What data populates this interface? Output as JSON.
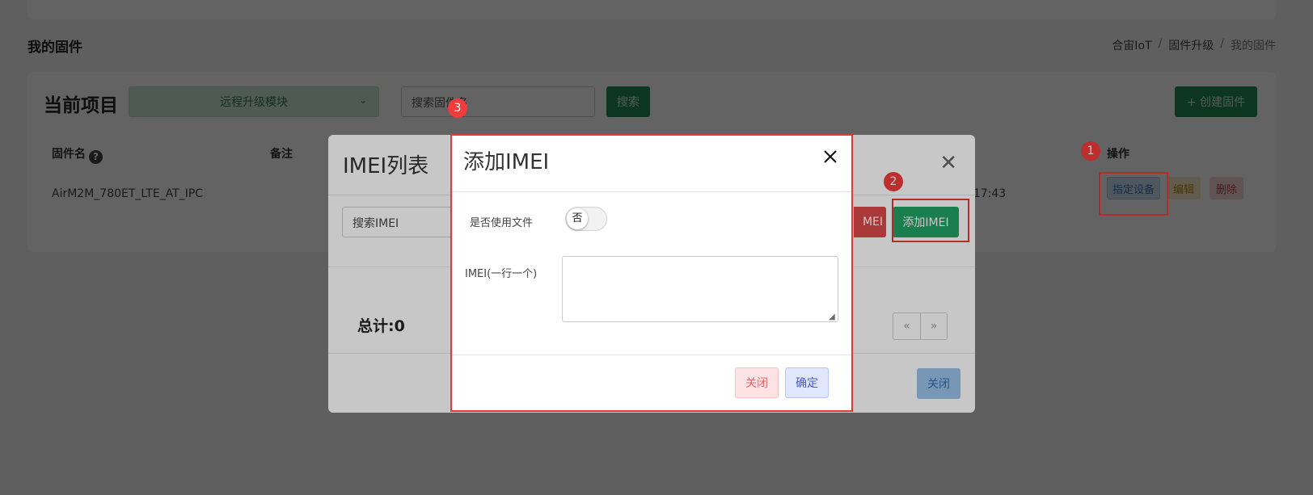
{
  "page": {
    "title": "我的固件",
    "breadcrumb": [
      "合宙IoT",
      "固件升级",
      "我的固件"
    ]
  },
  "toolbar": {
    "current_project_label": "当前项目",
    "project_select_value": "远程升级模块",
    "search_placeholder": "搜索固件名",
    "search_button": "搜索",
    "create_button": "+ 创建固件"
  },
  "table": {
    "headers": {
      "name": "固件名",
      "remark": "备注",
      "actions": "操作"
    },
    "rows": [
      {
        "name": "AirM2M_780ET_LTE_AT_IPC",
        "time_fragment": "-17 18:17:43",
        "assign": "指定设备",
        "edit": "编辑",
        "delete": "删除"
      }
    ]
  },
  "imei_list_modal": {
    "title": "IMEI列表",
    "search_placeholder": "搜索IMEI",
    "delete_button_partial": "MEI",
    "add_button": "添加IMEI",
    "total_label": "总计:0",
    "pager": [
      "«",
      "»"
    ],
    "close_button": "关闭"
  },
  "add_imei_modal": {
    "title": "添加IMEI",
    "use_file_label": "是否使用文件",
    "use_file_toggle": "否",
    "imei_label": "IMEI(一行一个)",
    "imei_value": "",
    "close_button": "关闭",
    "confirm_button": "确定"
  },
  "annotations": {
    "badges": [
      "1",
      "2",
      "3"
    ]
  },
  "colors": {
    "highlight": "#e53935",
    "badge": "#f23b3b",
    "primary_green": "#218c52",
    "add_green": "#21a366",
    "danger_red": "#dc4a4a"
  }
}
